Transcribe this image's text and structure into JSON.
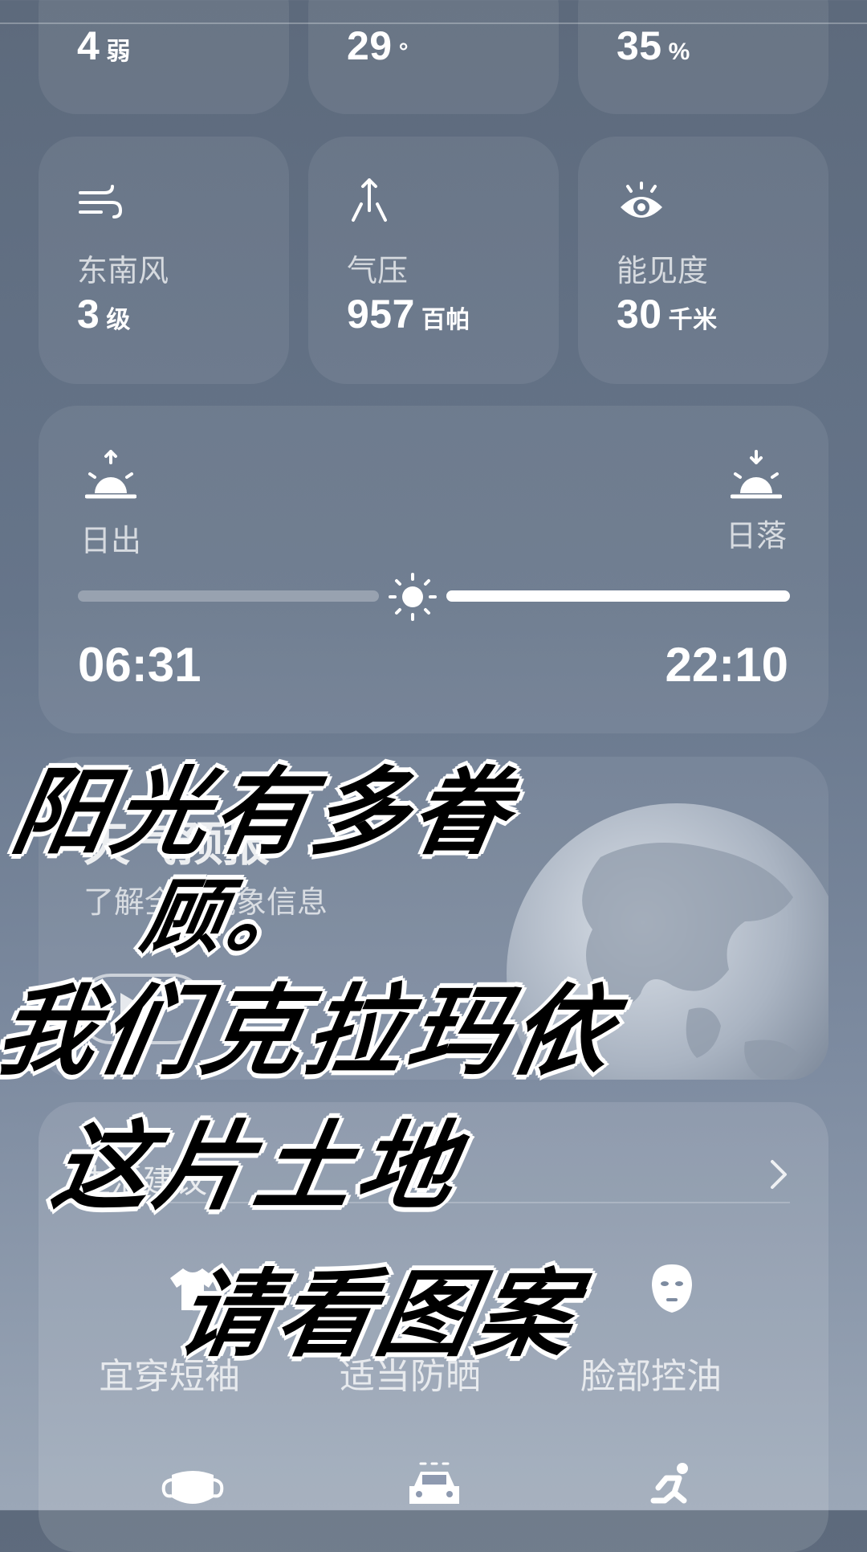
{
  "top_row": [
    {
      "value": "4",
      "unit": "弱"
    },
    {
      "value": "29",
      "unit": "°"
    },
    {
      "value": "35",
      "unit": "%"
    }
  ],
  "metrics": [
    {
      "icon": "wind-icon",
      "label": "东南风",
      "value": "3",
      "unit": "级"
    },
    {
      "icon": "pressure-icon",
      "label": "气压",
      "value": "957",
      "unit": "百帕"
    },
    {
      "icon": "eye-icon",
      "label": "能见度",
      "value": "30",
      "unit": "千米"
    }
  ],
  "sun": {
    "sunrise_label": "日出",
    "sunset_label": "日落",
    "sunrise_time": "06:31",
    "sunset_time": "22:10",
    "progress": 0.47
  },
  "forecast": {
    "title": "天气预报",
    "subtitle": "了解全球气象信息"
  },
  "advice": {
    "title": "生活建议",
    "items": [
      {
        "icon": "tshirt-icon",
        "label": "宜穿短袖"
      },
      {
        "icon": "sunscreen-icon",
        "label": "适当防晒"
      },
      {
        "icon": "face-mask-icon",
        "label": "脸部控油"
      }
    ],
    "bottom_icons": [
      "mask-icon",
      "car-icon",
      "running-icon"
    ]
  },
  "overlay_text": [
    "阳光有多眷",
    "顾。",
    "我们克拉玛依",
    "这片土地",
    "请看图案"
  ]
}
